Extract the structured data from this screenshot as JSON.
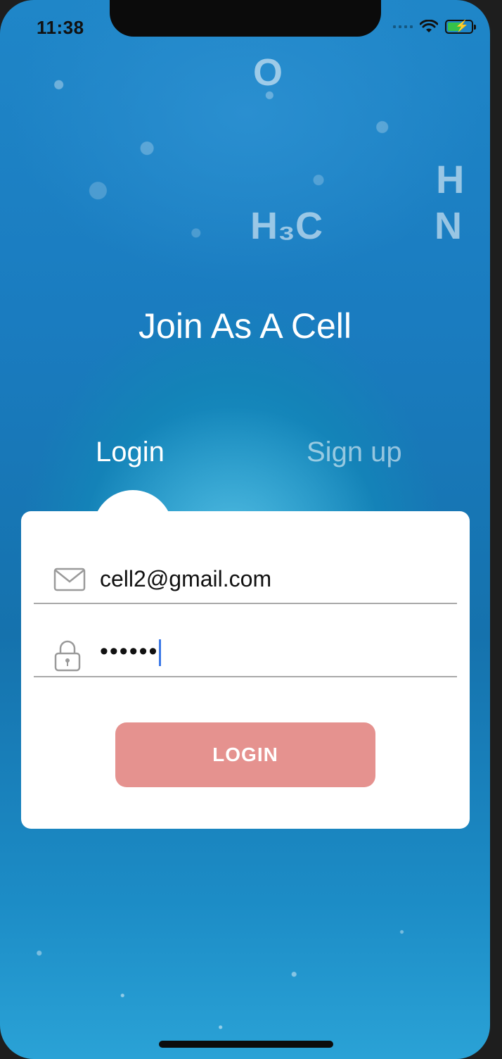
{
  "status_bar": {
    "time": "11:38",
    "battery_color": "#36c24a"
  },
  "title": "Join As A Cell",
  "tabs": {
    "login": "Login",
    "signup": "Sign up",
    "active": "login"
  },
  "form": {
    "email": {
      "icon": "envelope-icon",
      "value": "cell2@gmail.com"
    },
    "password": {
      "icon": "lock-icon",
      "value": "••••••"
    },
    "login_button_label": "LOGIN"
  },
  "colors": {
    "button": "#e5928f",
    "accent_caret": "#3b78e7",
    "card": "#ffffff"
  }
}
